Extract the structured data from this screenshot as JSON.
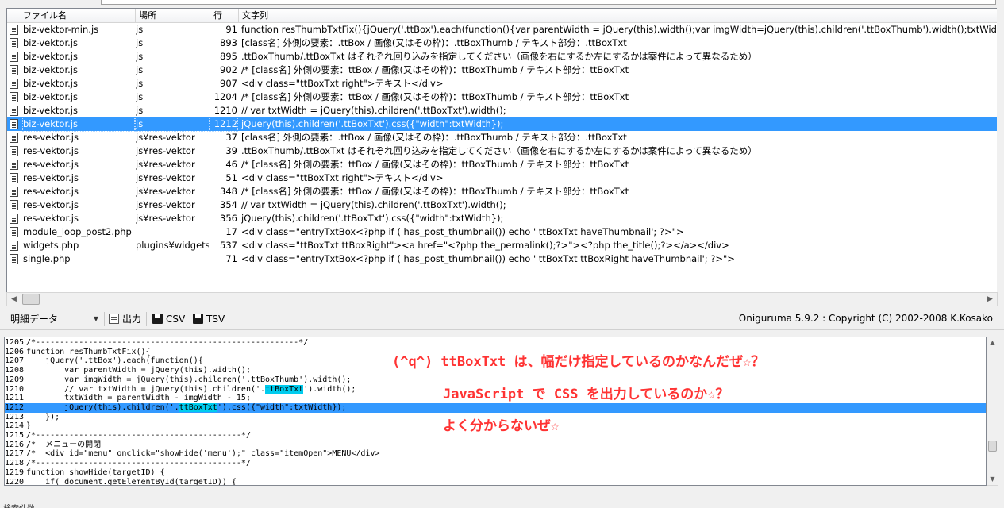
{
  "headers": {
    "file": "ファイル名",
    "place": "場所",
    "line": "行",
    "text": "文字列"
  },
  "rows": [
    {
      "file": "biz-vektor-min.js",
      "place": "js",
      "line": "91",
      "text": "function resThumbTxtFix(){jQuery('.ttBox').each(function(){var parentWidth = jQuery(this).width();var imgWidth=jQuery(this).children('.ttBoxThumb').width();txtWidth=par",
      "selected": false
    },
    {
      "file": "biz-vektor.js",
      "place": "js",
      "line": "893",
      "text": "[class名] 外側の要素：.ttBox / 画像(又はその枠)：.ttBoxThumb / テキスト部分：.ttBoxTxt",
      "selected": false
    },
    {
      "file": "biz-vektor.js",
      "place": "js",
      "line": "895",
      "text": ".ttBoxThumb/.ttBoxTxt はそれぞれ回り込みを指定してください（画像を右にするか左にするかは案件によって異なるため）",
      "selected": false
    },
    {
      "file": "biz-vektor.js",
      "place": "js",
      "line": "902",
      "text": "/*        [class名] 外側の要素：ttBox / 画像(又はその枠)：ttBoxThumb / テキスト部分：ttBoxTxt",
      "selected": false
    },
    {
      "file": "biz-vektor.js",
      "place": "js",
      "line": "907",
      "text": "<div class=\"ttBoxTxt right\">テキスト</div>",
      "selected": false
    },
    {
      "file": "biz-vektor.js",
      "place": "js",
      "line": "1204",
      "text": "/*        [class名] 外側の要素：ttBox / 画像(又はその枠)：ttBoxThumb / テキスト部分：ttBoxTxt",
      "selected": false
    },
    {
      "file": "biz-vektor.js",
      "place": "js",
      "line": "1210",
      "text": "        // var txtWidth = jQuery(this).children('.ttBoxTxt').width();",
      "selected": false
    },
    {
      "file": "biz-vektor.js",
      "place": "js",
      "line": "1212",
      "text": "        jQuery(this).children('.ttBoxTxt').css({\"width\":txtWidth});",
      "selected": true
    },
    {
      "file": "res-vektor.js",
      "place": "js¥res-vektor",
      "line": "37",
      "text": "[class名] 外側の要素：.ttBox / 画像(又はその枠)：.ttBoxThumb / テキスト部分：.ttBoxTxt",
      "selected": false
    },
    {
      "file": "res-vektor.js",
      "place": "js¥res-vektor",
      "line": "39",
      "text": ".ttBoxThumb/.ttBoxTxt はそれぞれ回り込みを指定してください（画像を右にするか左にするかは案件によって異なるため）",
      "selected": false
    },
    {
      "file": "res-vektor.js",
      "place": "js¥res-vektor",
      "line": "46",
      "text": "/*        [class名] 外側の要素：ttBox / 画像(又はその枠)：ttBoxThumb / テキスト部分：ttBoxTxt",
      "selected": false
    },
    {
      "file": "res-vektor.js",
      "place": "js¥res-vektor",
      "line": "51",
      "text": "<div class=\"ttBoxTxt right\">テキスト</div>",
      "selected": false
    },
    {
      "file": "res-vektor.js",
      "place": "js¥res-vektor",
      "line": "348",
      "text": "/*        [class名] 外側の要素：ttBox / 画像(又はその枠)：ttBoxThumb / テキスト部分：ttBoxTxt",
      "selected": false
    },
    {
      "file": "res-vektor.js",
      "place": "js¥res-vektor",
      "line": "354",
      "text": "        // var txtWidth = jQuery(this).children('.ttBoxTxt').width();",
      "selected": false
    },
    {
      "file": "res-vektor.js",
      "place": "js¥res-vektor",
      "line": "356",
      "text": "        jQuery(this).children('.ttBoxTxt').css({\"width\":txtWidth});",
      "selected": false
    },
    {
      "file": "module_loop_post2.php",
      "place": "",
      "line": "17",
      "text": "    <div class=\"entryTxtBox<?php if ( has_post_thumbnail()) echo ' ttBoxTxt haveThumbnail'; ?>\">",
      "selected": false
    },
    {
      "file": "widgets.php",
      "place": "plugins¥widgets",
      "line": "537",
      "text": "                    <div class=\"ttBoxTxt ttBoxRight\"><a href=\"<?php the_permalink();?>\"><?php the_title();?></a></div>",
      "selected": false
    },
    {
      "file": "single.php",
      "place": "",
      "line": "71",
      "text": "      <div class=\"entryTxtBox<?php if ( has_post_thumbnail()) echo ' ttBoxTxt ttBoxRight haveThumbnail'; ?>\">",
      "selected": false
    }
  ],
  "toolbar": {
    "view_select": "明細データ",
    "output_label": "出力",
    "csv_label": "CSV",
    "tsv_label": "TSV",
    "copyright": "Oniguruma 5.9.2 : Copyright (C) 2002-2008 K.Kosako"
  },
  "code_lines": [
    {
      "ln": "1205",
      "pre": "/*-------------------------------------------------------*/",
      "mark": "",
      "post": "",
      "hl": false
    },
    {
      "ln": "1206",
      "pre": "function resThumbTxtFix(){",
      "mark": "",
      "post": "",
      "hl": false
    },
    {
      "ln": "1207",
      "pre": "    jQuery('.ttBox').each(function(){",
      "mark": "",
      "post": "",
      "hl": false
    },
    {
      "ln": "1208",
      "pre": "        var parentWidth = jQuery(this).width();",
      "mark": "",
      "post": "",
      "hl": false
    },
    {
      "ln": "1209",
      "pre": "        var imgWidth = jQuery(this).children('.ttBoxThumb').width();",
      "mark": "",
      "post": "",
      "hl": false
    },
    {
      "ln": "1210",
      "pre": "        // var txtWidth = jQuery(this).children('.",
      "mark": "ttBoxTxt",
      "post": "').width();",
      "hl": false
    },
    {
      "ln": "1211",
      "pre": "        txtWidth = parentWidth - imgWidth - 15;",
      "mark": "",
      "post": "",
      "hl": false
    },
    {
      "ln": "1212",
      "pre": "        jQuery(this).children('.",
      "mark": "ttBoxTxt",
      "post": "').css({\"width\":txtWidth});",
      "hl": true
    },
    {
      "ln": "1213",
      "pre": "    });",
      "mark": "",
      "post": "",
      "hl": false
    },
    {
      "ln": "1214",
      "pre": "}",
      "mark": "",
      "post": "",
      "hl": false
    },
    {
      "ln": "1215",
      "pre": "/*-------------------------------------------*/",
      "mark": "",
      "post": "",
      "hl": false
    },
    {
      "ln": "1216",
      "pre": "/*  メニューの開閉",
      "mark": "",
      "post": "",
      "hl": false
    },
    {
      "ln": "1217",
      "pre": "/*  <div id=\"menu\" onclick=\"showHide('menu');\" class=\"itemOpen\">MENU</div>",
      "mark": "",
      "post": "",
      "hl": false
    },
    {
      "ln": "1218",
      "pre": "/*-------------------------------------------*/",
      "mark": "",
      "post": "",
      "hl": false
    },
    {
      "ln": "1219",
      "pre": "function showHide(targetID) {",
      "mark": "",
      "post": "",
      "hl": false
    },
    {
      "ln": "1220",
      "pre": "    if( document.getElementById(targetID)) {",
      "mark": "",
      "post": "",
      "hl": false
    }
  ],
  "comments": [
    "(^q^) ttBoxTxt は、幅だけ指定しているのかなんだぜ☆？",
    "JavaScript で CSS を出力しているのか☆？",
    "よく分からないぜ☆"
  ],
  "status_text": "検索件数"
}
